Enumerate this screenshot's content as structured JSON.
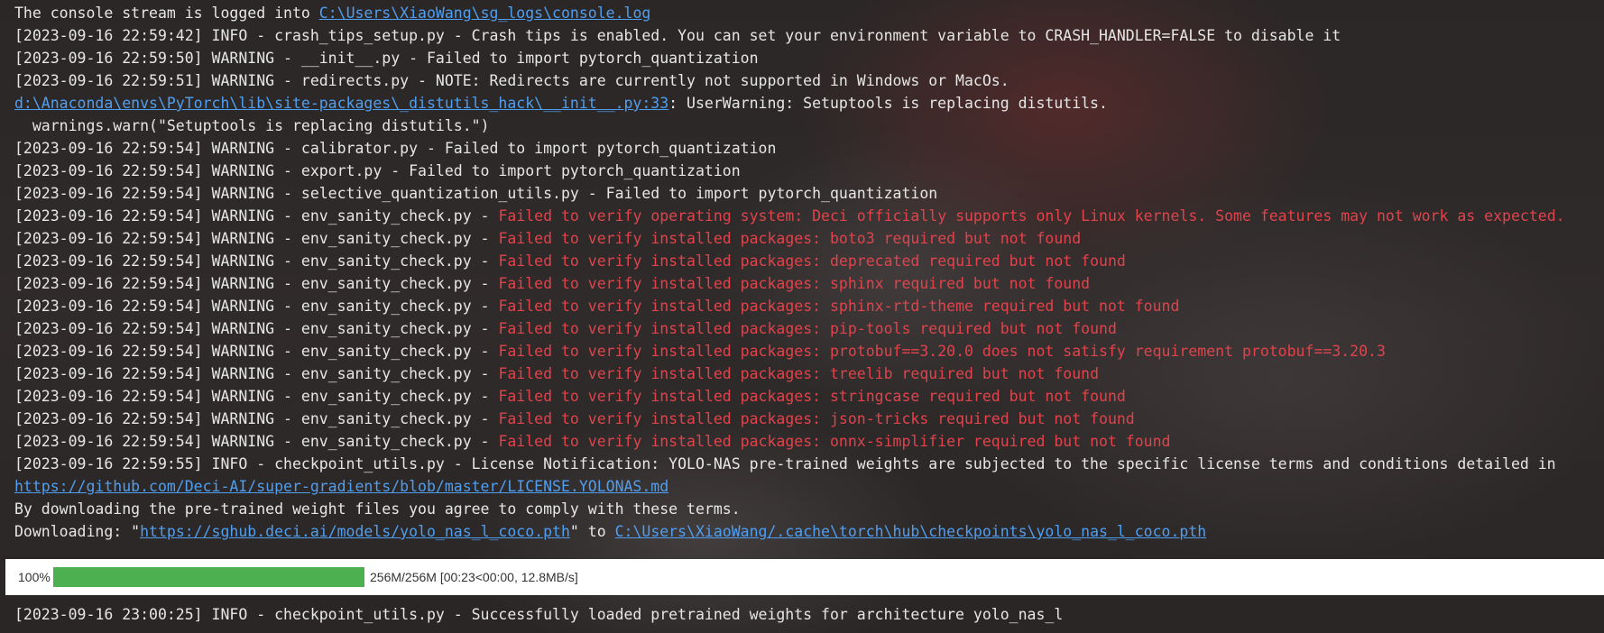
{
  "lines": [
    {
      "parts": [
        {
          "t": "The console stream is logged into "
        },
        {
          "t": "C:\\Users\\XiaoWang\\sg_logs\\console.log",
          "s": "link"
        }
      ]
    },
    {
      "parts": [
        {
          "t": "[2023-09-16 22:59:42] INFO - crash_tips_setup.py - Crash tips is enabled. You can set your environment variable to CRASH_HANDLER=FALSE to disable it"
        }
      ]
    },
    {
      "parts": [
        {
          "t": "[2023-09-16 22:59:50] WARNING - __init__.py - Failed to import pytorch_quantization"
        }
      ]
    },
    {
      "parts": [
        {
          "t": "[2023-09-16 22:59:51] WARNING - redirects.py - NOTE: Redirects are currently not supported in Windows or MacOs."
        }
      ]
    },
    {
      "parts": [
        {
          "t": "d:\\Anaconda\\envs\\PyTorch\\lib\\site-packages\\_distutils_hack\\__init__.py:33",
          "s": "link"
        },
        {
          "t": ": UserWarning: Setuptools is replacing distutils."
        }
      ]
    },
    {
      "parts": [
        {
          "t": "  warnings.warn(\"Setuptools is replacing distutils.\")"
        }
      ]
    },
    {
      "parts": [
        {
          "t": "[2023-09-16 22:59:54] WARNING - calibrator.py - Failed to import pytorch_quantization"
        }
      ]
    },
    {
      "parts": [
        {
          "t": "[2023-09-16 22:59:54] WARNING - export.py - Failed to import pytorch_quantization"
        }
      ]
    },
    {
      "parts": [
        {
          "t": "[2023-09-16 22:59:54] WARNING - selective_quantization_utils.py - Failed to import pytorch_quantization"
        }
      ]
    },
    {
      "parts": [
        {
          "t": "[2023-09-16 22:59:54] WARNING - env_sanity_check.py - "
        },
        {
          "t": "Failed to verify operating system: Deci officially supports only Linux kernels. Some features may not work as expected.",
          "s": "err"
        }
      ]
    },
    {
      "parts": [
        {
          "t": "[2023-09-16 22:59:54] WARNING - env_sanity_check.py - "
        },
        {
          "t": "Failed to verify installed packages: boto3 required but not found",
          "s": "err"
        }
      ]
    },
    {
      "parts": [
        {
          "t": "[2023-09-16 22:59:54] WARNING - env_sanity_check.py - "
        },
        {
          "t": "Failed to verify installed packages: deprecated required but not found",
          "s": "err"
        }
      ]
    },
    {
      "parts": [
        {
          "t": "[2023-09-16 22:59:54] WARNING - env_sanity_check.py - "
        },
        {
          "t": "Failed to verify installed packages: sphinx required but not found",
          "s": "err"
        }
      ]
    },
    {
      "parts": [
        {
          "t": "[2023-09-16 22:59:54] WARNING - env_sanity_check.py - "
        },
        {
          "t": "Failed to verify installed packages: sphinx-rtd-theme required but not found",
          "s": "err"
        }
      ]
    },
    {
      "parts": [
        {
          "t": "[2023-09-16 22:59:54] WARNING - env_sanity_check.py - "
        },
        {
          "t": "Failed to verify installed packages: pip-tools required but not found",
          "s": "err"
        }
      ]
    },
    {
      "parts": [
        {
          "t": "[2023-09-16 22:59:54] WARNING - env_sanity_check.py - "
        },
        {
          "t": "Failed to verify installed packages: protobuf==3.20.0 does not satisfy requirement protobuf==3.20.3",
          "s": "err"
        }
      ]
    },
    {
      "parts": [
        {
          "t": "[2023-09-16 22:59:54] WARNING - env_sanity_check.py - "
        },
        {
          "t": "Failed to verify installed packages: treelib required but not found",
          "s": "err"
        }
      ]
    },
    {
      "parts": [
        {
          "t": "[2023-09-16 22:59:54] WARNING - env_sanity_check.py - "
        },
        {
          "t": "Failed to verify installed packages: stringcase required but not found",
          "s": "err"
        }
      ]
    },
    {
      "parts": [
        {
          "t": "[2023-09-16 22:59:54] WARNING - env_sanity_check.py - "
        },
        {
          "t": "Failed to verify installed packages: json-tricks required but not found",
          "s": "err"
        }
      ]
    },
    {
      "parts": [
        {
          "t": "[2023-09-16 22:59:54] WARNING - env_sanity_check.py - "
        },
        {
          "t": "Failed to verify installed packages: onnx-simplifier required but not found",
          "s": "err"
        }
      ]
    },
    {
      "parts": [
        {
          "t": "[2023-09-16 22:59:55] INFO - checkpoint_utils.py - License Notification: YOLO-NAS pre-trained weights are subjected to the specific license terms and conditions detailed in"
        }
      ]
    },
    {
      "parts": [
        {
          "t": "https://github.com/Deci-AI/super-gradients/blob/master/LICENSE.YOLONAS.md",
          "s": "link"
        }
      ]
    },
    {
      "parts": [
        {
          "t": "By downloading the pre-trained weight files you agree to comply with these terms."
        }
      ]
    },
    {
      "parts": [
        {
          "t": "Downloading: \""
        },
        {
          "t": "https://sghub.deci.ai/models/yolo_nas_l_coco.pth",
          "s": "link"
        },
        {
          "t": "\" to "
        },
        {
          "t": "C:\\Users\\XiaoWang/.cache\\torch\\hub\\checkpoints\\yolo_nas_l_coco.pth",
          "s": "link"
        }
      ]
    }
  ],
  "progress": {
    "percent_label": "100%",
    "fraction": 1.0,
    "info": "256M/256M [00:23<00:00, 12.8MB/s]"
  },
  "final_line": "[2023-09-16 23:00:25] INFO - checkpoint_utils.py - Successfully loaded pretrained weights for architecture yolo_nas_l",
  "colors": {
    "link": "#4f9ef0",
    "error": "#e0434b",
    "text": "#e6e6e6",
    "progress_fill": "#4cb050"
  }
}
